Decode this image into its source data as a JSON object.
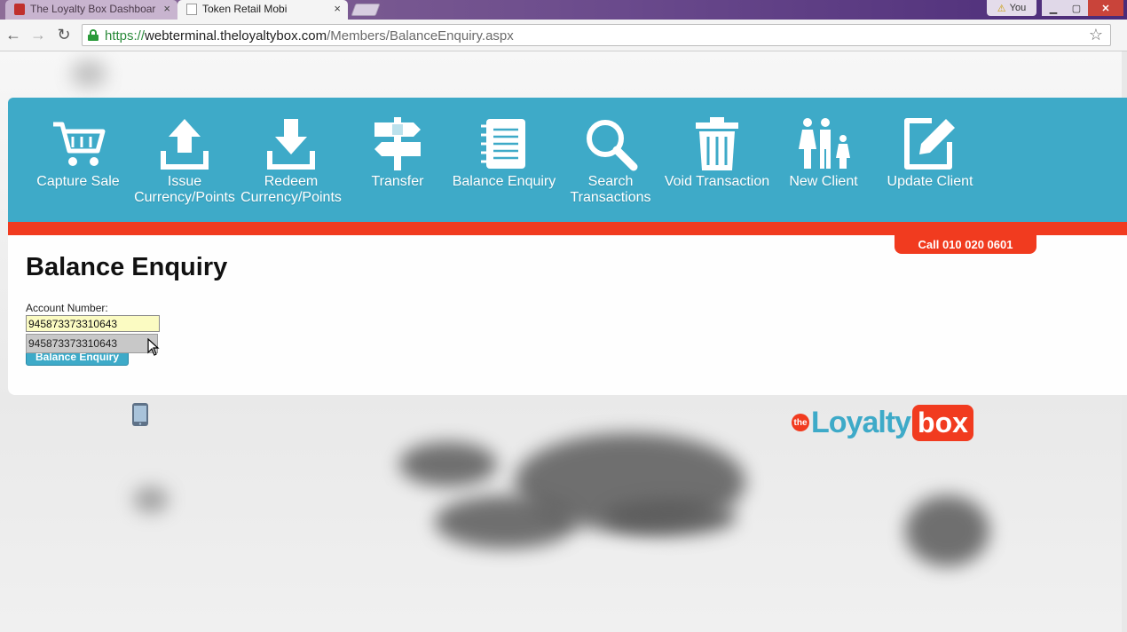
{
  "browser": {
    "tabs": [
      {
        "label": "The Loyalty Box Dashboar",
        "close": "×"
      },
      {
        "label": "Token Retail Mobi",
        "close": "×"
      }
    ],
    "user_label": "You",
    "url": {
      "protocol": "https://",
      "host": "webterminal.theloyaltybox.com",
      "path": "/Members/BalanceEnquiry.aspx"
    }
  },
  "nav": {
    "items": [
      {
        "id": "capture-sale",
        "label": "Capture Sale",
        "icon": "cart-icon"
      },
      {
        "id": "issue",
        "label": "Issue Currency/Points",
        "icon": "upload-icon"
      },
      {
        "id": "redeem",
        "label": "Redeem Currency/Points",
        "icon": "download-icon"
      },
      {
        "id": "transfer",
        "label": "Transfer",
        "icon": "signpost-icon"
      },
      {
        "id": "balance-enquiry",
        "label": "Balance Enquiry",
        "icon": "notebook-icon"
      },
      {
        "id": "search-transactions",
        "label": "Search Transactions",
        "icon": "magnifier-icon"
      },
      {
        "id": "void-transaction",
        "label": "Void Transaction",
        "icon": "trash-icon"
      },
      {
        "id": "new-client",
        "label": "New Client",
        "icon": "family-icon"
      },
      {
        "id": "update-client",
        "label": "Update Client",
        "icon": "edit-icon"
      }
    ]
  },
  "call_label": "Call 010 020 0601",
  "form": {
    "title": "Balance Enquiry",
    "account_label": "Account Number:",
    "account_value": "945873373310643",
    "autocomplete_option": "945873373310643",
    "button_label": "Balance Enquiry"
  },
  "logo": {
    "the": "the",
    "word": "Loyalty",
    "box": "box"
  },
  "colors": {
    "brand_blue": "#3eaac8",
    "brand_red": "#f13b1f",
    "input_highlight": "#fbfbc2"
  }
}
